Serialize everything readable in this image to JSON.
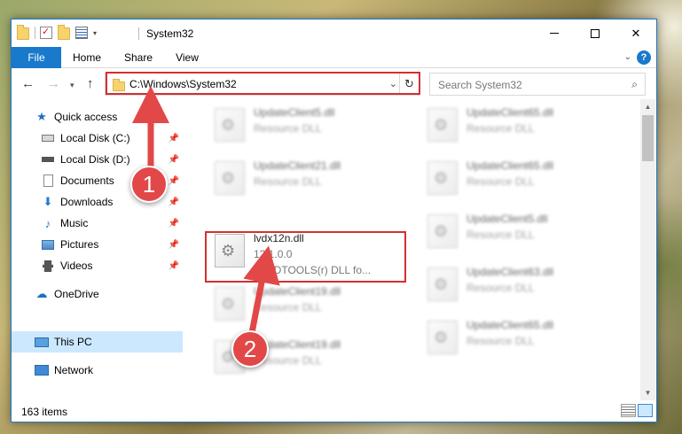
{
  "window": {
    "title": "System32",
    "controls": {
      "minimize": "—",
      "maximize": "☐",
      "close": "✕"
    }
  },
  "ribbon": {
    "tabs": [
      "File",
      "Home",
      "Share",
      "View"
    ],
    "help": "?"
  },
  "navbar": {
    "address": "C:\\Windows\\System32",
    "search_placeholder": "Search System32"
  },
  "sidebar": {
    "items": [
      {
        "label": "Quick access",
        "icon": "star-icon",
        "pinned": false
      },
      {
        "label": "Local Disk (C:)",
        "icon": "disk-icon",
        "pinned": true
      },
      {
        "label": "Local Disk (D:)",
        "icon": "disk-icon",
        "pinned": true
      },
      {
        "label": "Documents",
        "icon": "document-icon",
        "pinned": true
      },
      {
        "label": "Downloads",
        "icon": "download-icon",
        "pinned": true
      },
      {
        "label": "Music",
        "icon": "music-icon",
        "pinned": true
      },
      {
        "label": "Pictures",
        "icon": "pictures-icon",
        "pinned": true
      },
      {
        "label": "Videos",
        "icon": "videos-icon",
        "pinned": true
      },
      {
        "label": "OneDrive",
        "icon": "cloud-icon",
        "pinned": false
      },
      {
        "label": "This PC",
        "icon": "computer-icon",
        "pinned": false,
        "selected": true
      },
      {
        "label": "Network",
        "icon": "network-icon",
        "pinned": false
      }
    ]
  },
  "files": {
    "left": [
      {
        "name": "UpdateClient5.dll",
        "type": "Resource DLL"
      },
      {
        "name": "UpdateClient21.dll",
        "type": "Resource DLL"
      },
      {
        "name": "lvdx12n.dll",
        "type": "12.1.0.0",
        "desc": "LEADTOOLS(r) DLL fo..."
      },
      {
        "name": "UpdateClient19.dll",
        "type": "Resource DLL"
      },
      {
        "name": "UpdateClient19.dll",
        "type": "Resource DLL"
      }
    ],
    "right": [
      {
        "name": "UpdateClient65.dll",
        "type": "Resource DLL"
      },
      {
        "name": "UpdateClient65.dll",
        "type": "Resource DLL"
      },
      {
        "name": "UpdateClient5.dll",
        "type": "Resource DLL"
      },
      {
        "name": "UpdateClient63.dll",
        "type": "Resource DLL"
      },
      {
        "name": "UpdateClient65.dll",
        "type": "Resource DLL"
      }
    ]
  },
  "status": {
    "count": "163 items"
  },
  "callouts": {
    "one": "1",
    "two": "2"
  },
  "colors": {
    "accent": "#1979ca",
    "highlight": "#d33030",
    "badge": "#e24848",
    "selected": "#cce8ff"
  }
}
